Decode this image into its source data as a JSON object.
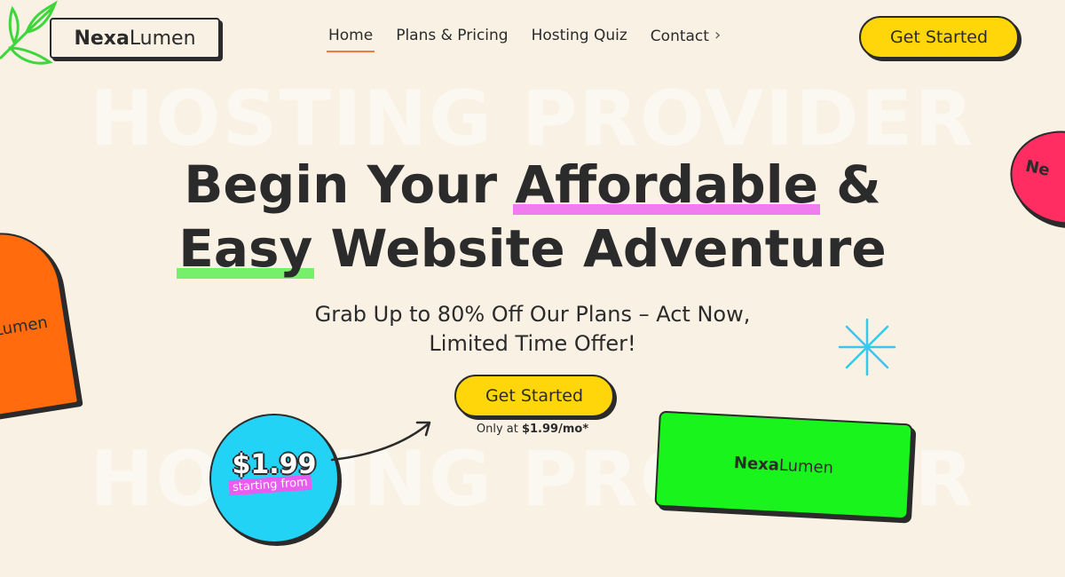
{
  "brand": {
    "name_bold": "Nexa",
    "name_light": "Lumen"
  },
  "nav": {
    "items": [
      {
        "label": "Home",
        "active": true
      },
      {
        "label": "Plans & Pricing"
      },
      {
        "label": "Hosting Quiz"
      },
      {
        "label": "Contact"
      }
    ]
  },
  "header": {
    "cta_label": "Get Started"
  },
  "watermark": {
    "text": "HOSTING PROVIDER"
  },
  "hero": {
    "headline_line1_pre": "Begin Your ",
    "headline_line1_highlight": "Affordable",
    "headline_line1_post": " &",
    "headline_line2_highlight": "Easy",
    "headline_line2_post": " Website Adventure",
    "subhead_line1": "Grab Up to 80% Off Our Plans – Act Now,",
    "subhead_line2": "Limited Time Offer!",
    "cta_label": "Get Started",
    "price_note_prefix": "Only at ",
    "price_note_value": "$1.99/mo*"
  },
  "badges": {
    "price": "$1.99",
    "price_sub": "starting from",
    "orange_card_text": "Lumen",
    "pink_card_text": "Ne",
    "green_card_bold": "Nexa",
    "green_card_light": "Lumen"
  },
  "colors": {
    "background": "#f8f1e4",
    "yellow": "#ffd60a",
    "pink_highlight": "#f07cf0",
    "green_highlight": "#76f06b",
    "orange": "#ff6b0d",
    "cyan": "#22d3f5",
    "green_card": "#19f51c",
    "pink_card": "#ff2d62"
  }
}
